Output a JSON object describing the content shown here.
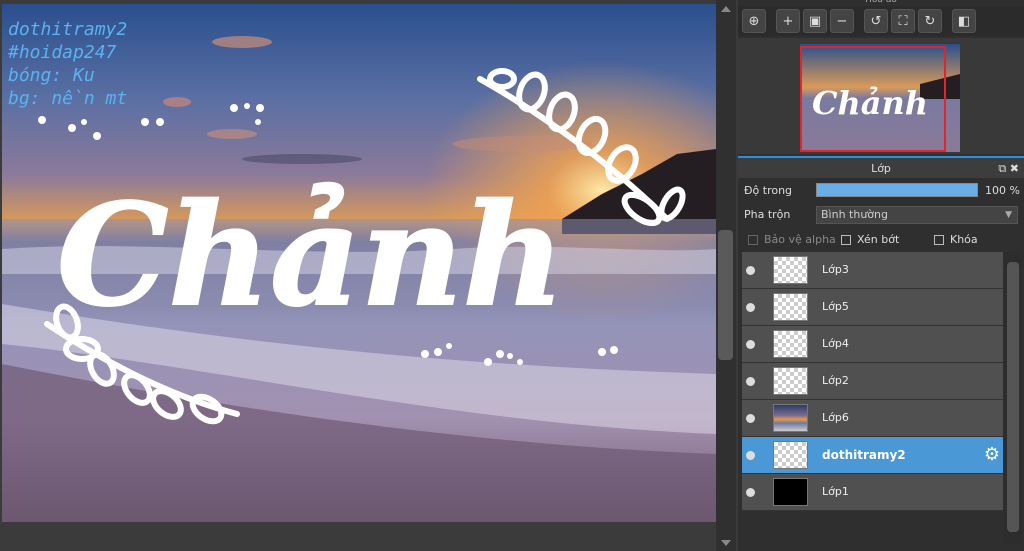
{
  "canvas": {
    "title_text": "Chảnh",
    "overlay_lines": [
      "dothitramy2",
      "#hoidap247",
      "bóng: Ku",
      "bg: nền mt"
    ]
  },
  "navigator": {
    "title": "Hoa đồ",
    "tools": [
      "zoom-fit-icon",
      "zoom-in-icon",
      "fit-screen-icon",
      "zoom-out-icon",
      "rotate-left-icon",
      "fullscreen-icon",
      "rotate-right-icon",
      "flip-icon"
    ]
  },
  "layers_panel": {
    "title": "Lớp",
    "opacity_label": "Độ trong",
    "opacity_value": "100 %",
    "opacity_fraction": 1.0,
    "blend_label": "Pha trộn",
    "blend_value": "Bình thường",
    "protect_alpha": "Bảo vệ alpha",
    "clipping": "Xén bớt",
    "lock": "Khóa",
    "layers": [
      {
        "name": "Lớp3",
        "thumb": "transparent",
        "selected": false
      },
      {
        "name": "Lớp5",
        "thumb": "transparent",
        "selected": false
      },
      {
        "name": "Lớp4",
        "thumb": "transparent",
        "selected": false
      },
      {
        "name": "Lớp2",
        "thumb": "transparent",
        "selected": false
      },
      {
        "name": "Lớp6",
        "thumb": "photo",
        "selected": false
      },
      {
        "name": "dothitramy2",
        "thumb": "transparent",
        "selected": true
      },
      {
        "name": "Lớp1",
        "thumb": "black",
        "selected": false
      }
    ]
  },
  "colors": {
    "accent": "#4a98d6",
    "overlay_text": "#5ab2ef",
    "nav_frame": "#e0262a"
  }
}
